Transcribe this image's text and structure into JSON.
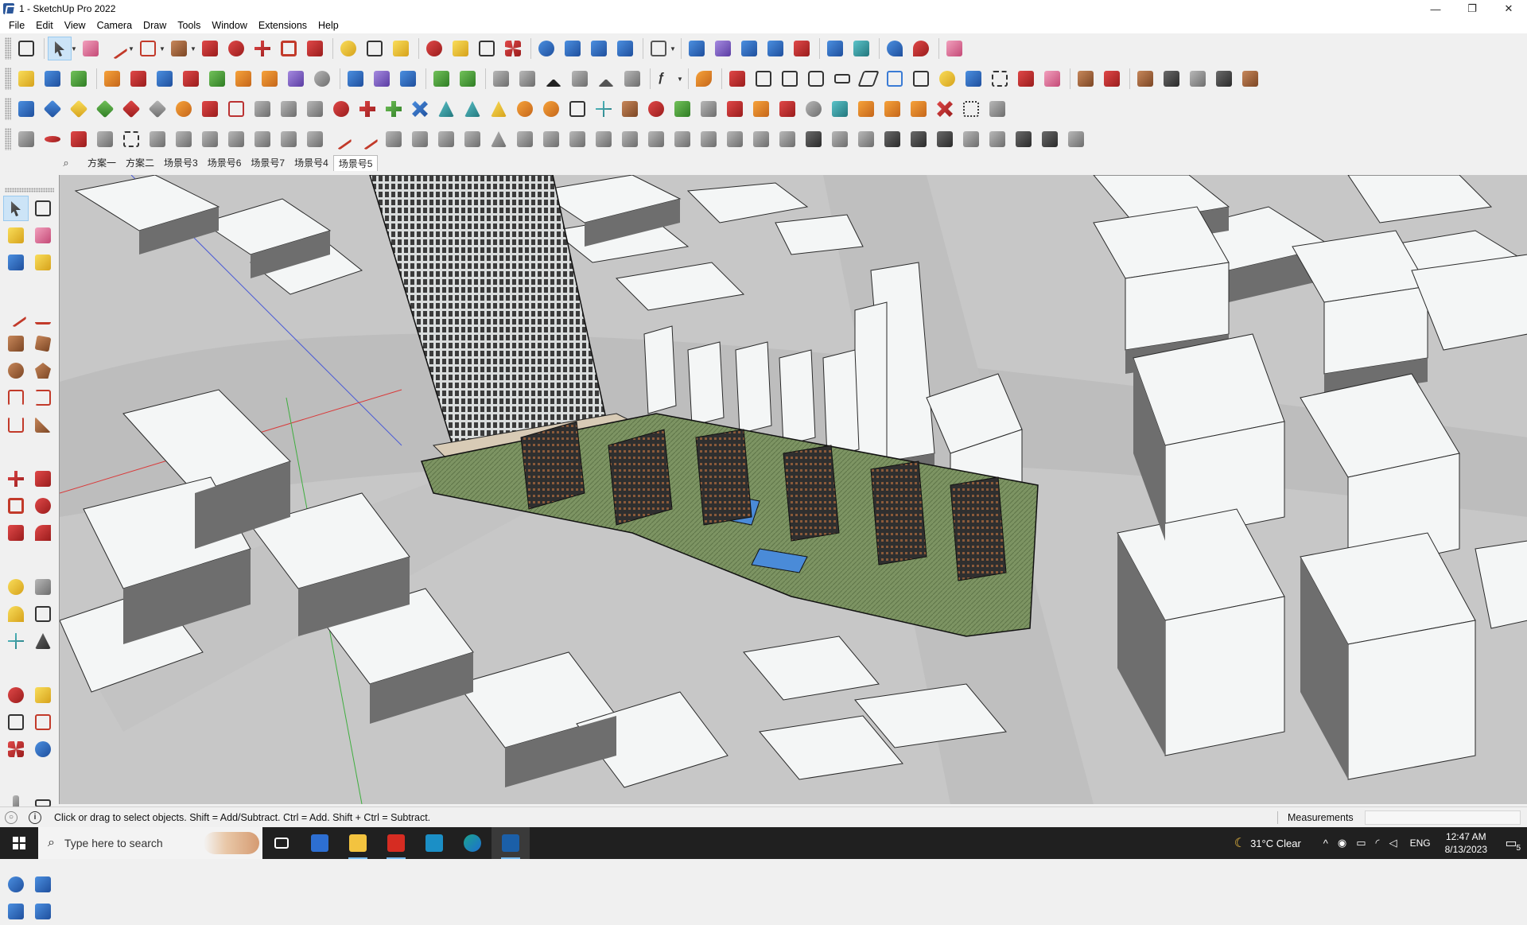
{
  "window": {
    "title": "1 - SketchUp Pro 2022",
    "minimize": "—",
    "maximize": "❐",
    "close": "✕"
  },
  "menu": [
    "File",
    "Edit",
    "View",
    "Camera",
    "Draw",
    "Tools",
    "Window",
    "Extensions",
    "Help"
  ],
  "scenes": {
    "search_icon": "⌕",
    "tabs": [
      "方案一",
      "方案二",
      "场景号3",
      "场景号6",
      "场景号7",
      "场景号4",
      "场景号5"
    ],
    "active_index": 6
  },
  "status": {
    "hint": "Click or drag to select objects. Shift = Add/Subtract. Ctrl = Add. Shift + Ctrl = Subtract.",
    "info_icon": "i",
    "geo_icon": "○",
    "measurements_label": "Measurements",
    "measurements_value": ""
  },
  "taskbar": {
    "search_placeholder": "Type here to search",
    "search_icon": "⌕",
    "apps": [
      {
        "name": "task-view",
        "color": "#ffffff"
      },
      {
        "name": "calculator",
        "color": "#2d6fd2"
      },
      {
        "name": "file-explorer",
        "color": "#f3c33f"
      },
      {
        "name": "acrobat",
        "color": "#d62c22"
      },
      {
        "name": "app-3",
        "color": "#1b8fc6"
      },
      {
        "name": "edge",
        "color": "#1ba38f"
      },
      {
        "name": "sketchup",
        "color": "#1b5fa8"
      }
    ],
    "weather": "31°C  Clear",
    "moon_icon": "☾",
    "tray_up": "^",
    "language": "ENG",
    "time": "12:47 AM",
    "date": "8/13/2023",
    "notification_count": "5",
    "notification_icon": "▭"
  },
  "colors": {
    "viewport_ground": "#c7c7c7",
    "building_light": "#f4f6f6",
    "building_shadow": "#6e6e6e",
    "accent_blue": "#cce4f7"
  }
}
